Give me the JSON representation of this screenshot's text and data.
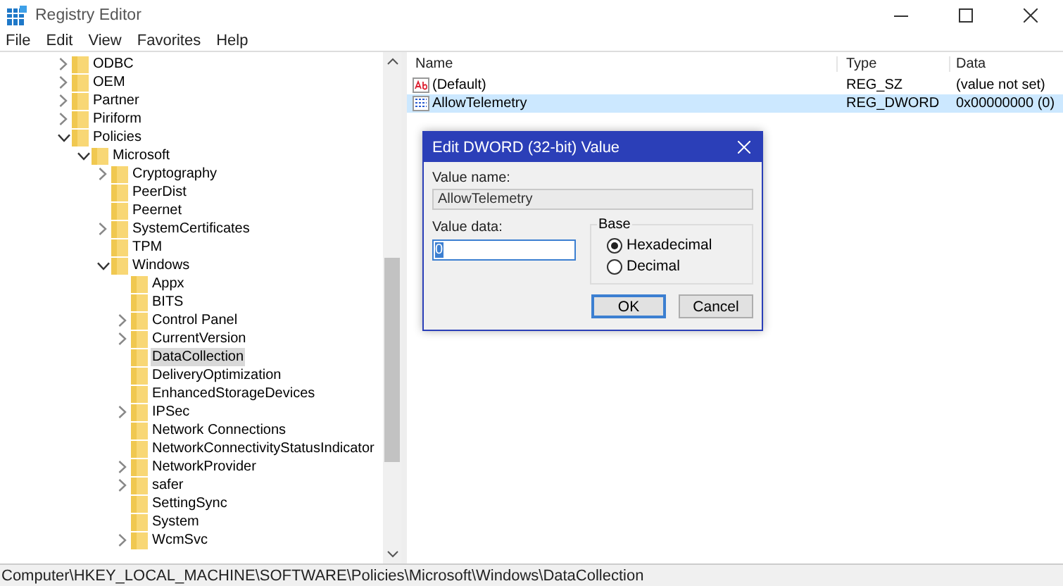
{
  "window": {
    "title": "Registry Editor"
  },
  "menu": [
    "File",
    "Edit",
    "View",
    "Favorites",
    "Help"
  ],
  "tree": [
    {
      "label": "ODBC",
      "expanded": false,
      "selected": false
    },
    {
      "label": "OEM",
      "expanded": false,
      "selected": false
    },
    {
      "label": "Partner",
      "expanded": false,
      "selected": false
    },
    {
      "label": "Piriform",
      "expanded": false,
      "selected": false
    },
    {
      "label": "Policies",
      "expanded": true,
      "selected": false,
      "children": [
        {
          "label": "Microsoft",
          "expanded": true,
          "selected": false,
          "children": [
            {
              "label": "Cryptography",
              "expanded": false,
              "selected": false
            },
            {
              "label": "PeerDist",
              "selected": false
            },
            {
              "label": "Peernet",
              "selected": false
            },
            {
              "label": "SystemCertificates",
              "expanded": false,
              "selected": false
            },
            {
              "label": "TPM",
              "selected": false
            },
            {
              "label": "Windows",
              "expanded": true,
              "selected": false,
              "children": [
                {
                  "label": "Appx",
                  "selected": false
                },
                {
                  "label": "BITS",
                  "selected": false
                },
                {
                  "label": "Control Panel",
                  "expanded": false,
                  "selected": false
                },
                {
                  "label": "CurrentVersion",
                  "expanded": false,
                  "selected": false
                },
                {
                  "label": "DataCollection",
                  "selected": true
                },
                {
                  "label": "DeliveryOptimization",
                  "selected": false
                },
                {
                  "label": "EnhancedStorageDevices",
                  "selected": false
                },
                {
                  "label": "IPSec",
                  "expanded": false,
                  "selected": false
                },
                {
                  "label": "Network Connections",
                  "selected": false
                },
                {
                  "label": "NetworkConnectivityStatusIndicator",
                  "selected": false
                },
                {
                  "label": "NetworkProvider",
                  "expanded": false,
                  "selected": false
                },
                {
                  "label": "safer",
                  "expanded": false,
                  "selected": false
                },
                {
                  "label": "SettingSync",
                  "selected": false
                },
                {
                  "label": "System",
                  "selected": false
                },
                {
                  "label": "WcmSvc",
                  "expanded": false,
                  "selected": false
                }
              ]
            }
          ]
        }
      ]
    }
  ],
  "values": {
    "columns": [
      "Name",
      "Type",
      "Data"
    ],
    "rows": [
      {
        "kind": "string",
        "name": "(Default)",
        "type": "REG_SZ",
        "data": "(value not set)",
        "selected": false
      },
      {
        "kind": "binary",
        "name": "AllowTelemetry",
        "type": "REG_DWORD",
        "data": "0x00000000 (0)",
        "selected": true
      }
    ]
  },
  "dialog": {
    "title": "Edit DWORD (32-bit) Value",
    "value_name_label": "Value name:",
    "value_name": "AllowTelemetry",
    "value_data_label": "Value data:",
    "value_data": "0",
    "base_label": "Base",
    "radios": [
      {
        "label": "Hexadecimal",
        "selected": true
      },
      {
        "label": "Decimal",
        "selected": false
      }
    ],
    "buttons": [
      {
        "label": "OK",
        "default": true
      },
      {
        "label": "Cancel",
        "default": false
      }
    ]
  },
  "status_bar": "Computer\\HKEY_LOCAL_MACHINE\\SOFTWARE\\Policies\\Microsoft\\Windows\\DataCollection"
}
